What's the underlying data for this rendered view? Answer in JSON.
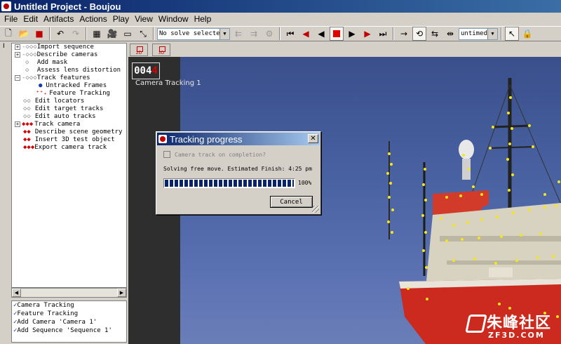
{
  "window": {
    "title": "Untitled Project - Boujou"
  },
  "menu": [
    "File",
    "Edit",
    "Artifacts",
    "Actions",
    "Play",
    "View",
    "Window",
    "Help"
  ],
  "toolbar": {
    "solve_select": "No solve selected",
    "timing_select": "untimed"
  },
  "tree": {
    "items": [
      {
        "label": "Import sequence"
      },
      {
        "label": "Describe cameras"
      },
      {
        "label": "Add mask"
      },
      {
        "label": "Assess lens distortion"
      },
      {
        "label": "Track features"
      },
      {
        "label": "Untracked Frames"
      },
      {
        "label": "Feature Tracking"
      },
      {
        "label": "Edit locators"
      },
      {
        "label": "Edit target tracks"
      },
      {
        "label": "Edit auto tracks"
      },
      {
        "label": "Track camera"
      },
      {
        "label": "Describe scene geometry"
      },
      {
        "label": "Insert 3D test object"
      },
      {
        "label": "Export camera track"
      }
    ]
  },
  "history": [
    "Camera Tracking",
    "Feature Tracking",
    "Add Camera 'Camera 1'",
    "Add Sequence  'Sequence  1'"
  ],
  "viewport": {
    "tabs": [
      "2D",
      "3D"
    ],
    "frame_number": "004",
    "frame_digit_red": "4",
    "camera_label": "Camera Tracking 1"
  },
  "dialog": {
    "title": "Tracking progress",
    "checkbox_label": "Camera track on completion?",
    "status": "Solving free move. Estimated Finish: 4:25 pm",
    "progress": 1.0,
    "progress_text": "100%",
    "cancel_label": "Cancel"
  },
  "watermark": {
    "line1": "朱峰社区",
    "line2": "ZF3D.COM"
  },
  "colors": {
    "title_bar": "#0a246a",
    "selection": "#0a246a",
    "accent_red": "#c00000",
    "track_point": "#f5e61c"
  }
}
